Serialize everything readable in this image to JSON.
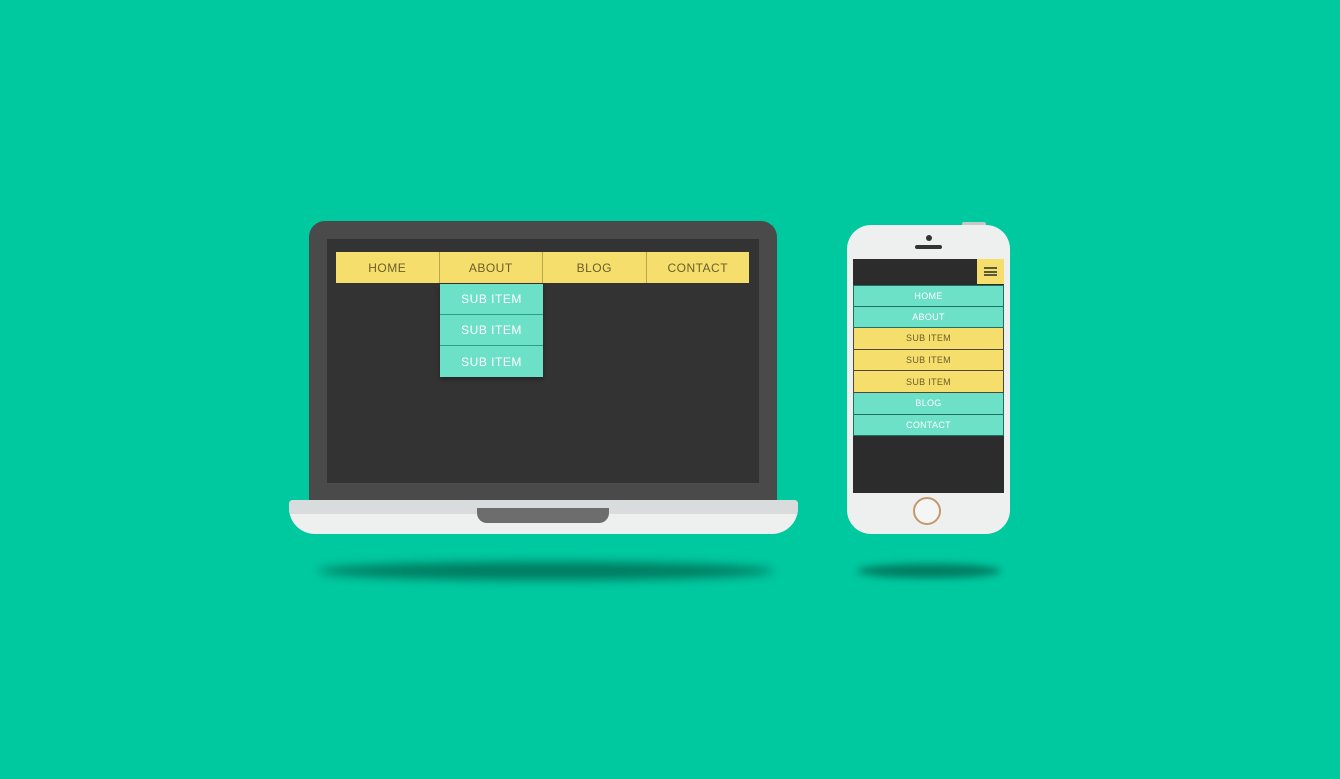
{
  "colors": {
    "background": "#00c9a0",
    "menu_yellow": "#f5de6b",
    "menu_teal": "#6de0c8",
    "screen_dark": "#333333"
  },
  "desktop_nav": {
    "items": [
      {
        "label": "HOME"
      },
      {
        "label": "ABOUT"
      },
      {
        "label": "BLOG"
      },
      {
        "label": "CONTACT"
      }
    ],
    "submenu": [
      {
        "label": "SUB ITEM"
      },
      {
        "label": "SUB ITEM"
      },
      {
        "label": "SUB ITEM"
      }
    ]
  },
  "mobile_nav": {
    "menu_icon": "hamburger-icon",
    "items": [
      {
        "label": "HOME",
        "style": "teal"
      },
      {
        "label": "ABOUT",
        "style": "teal"
      },
      {
        "label": "SUB ITEM",
        "style": "yellow"
      },
      {
        "label": "SUB ITEM",
        "style": "yellow"
      },
      {
        "label": "SUB ITEM",
        "style": "yellow"
      },
      {
        "label": "BLOG",
        "style": "teal"
      },
      {
        "label": "CONTACT",
        "style": "teal"
      }
    ]
  }
}
